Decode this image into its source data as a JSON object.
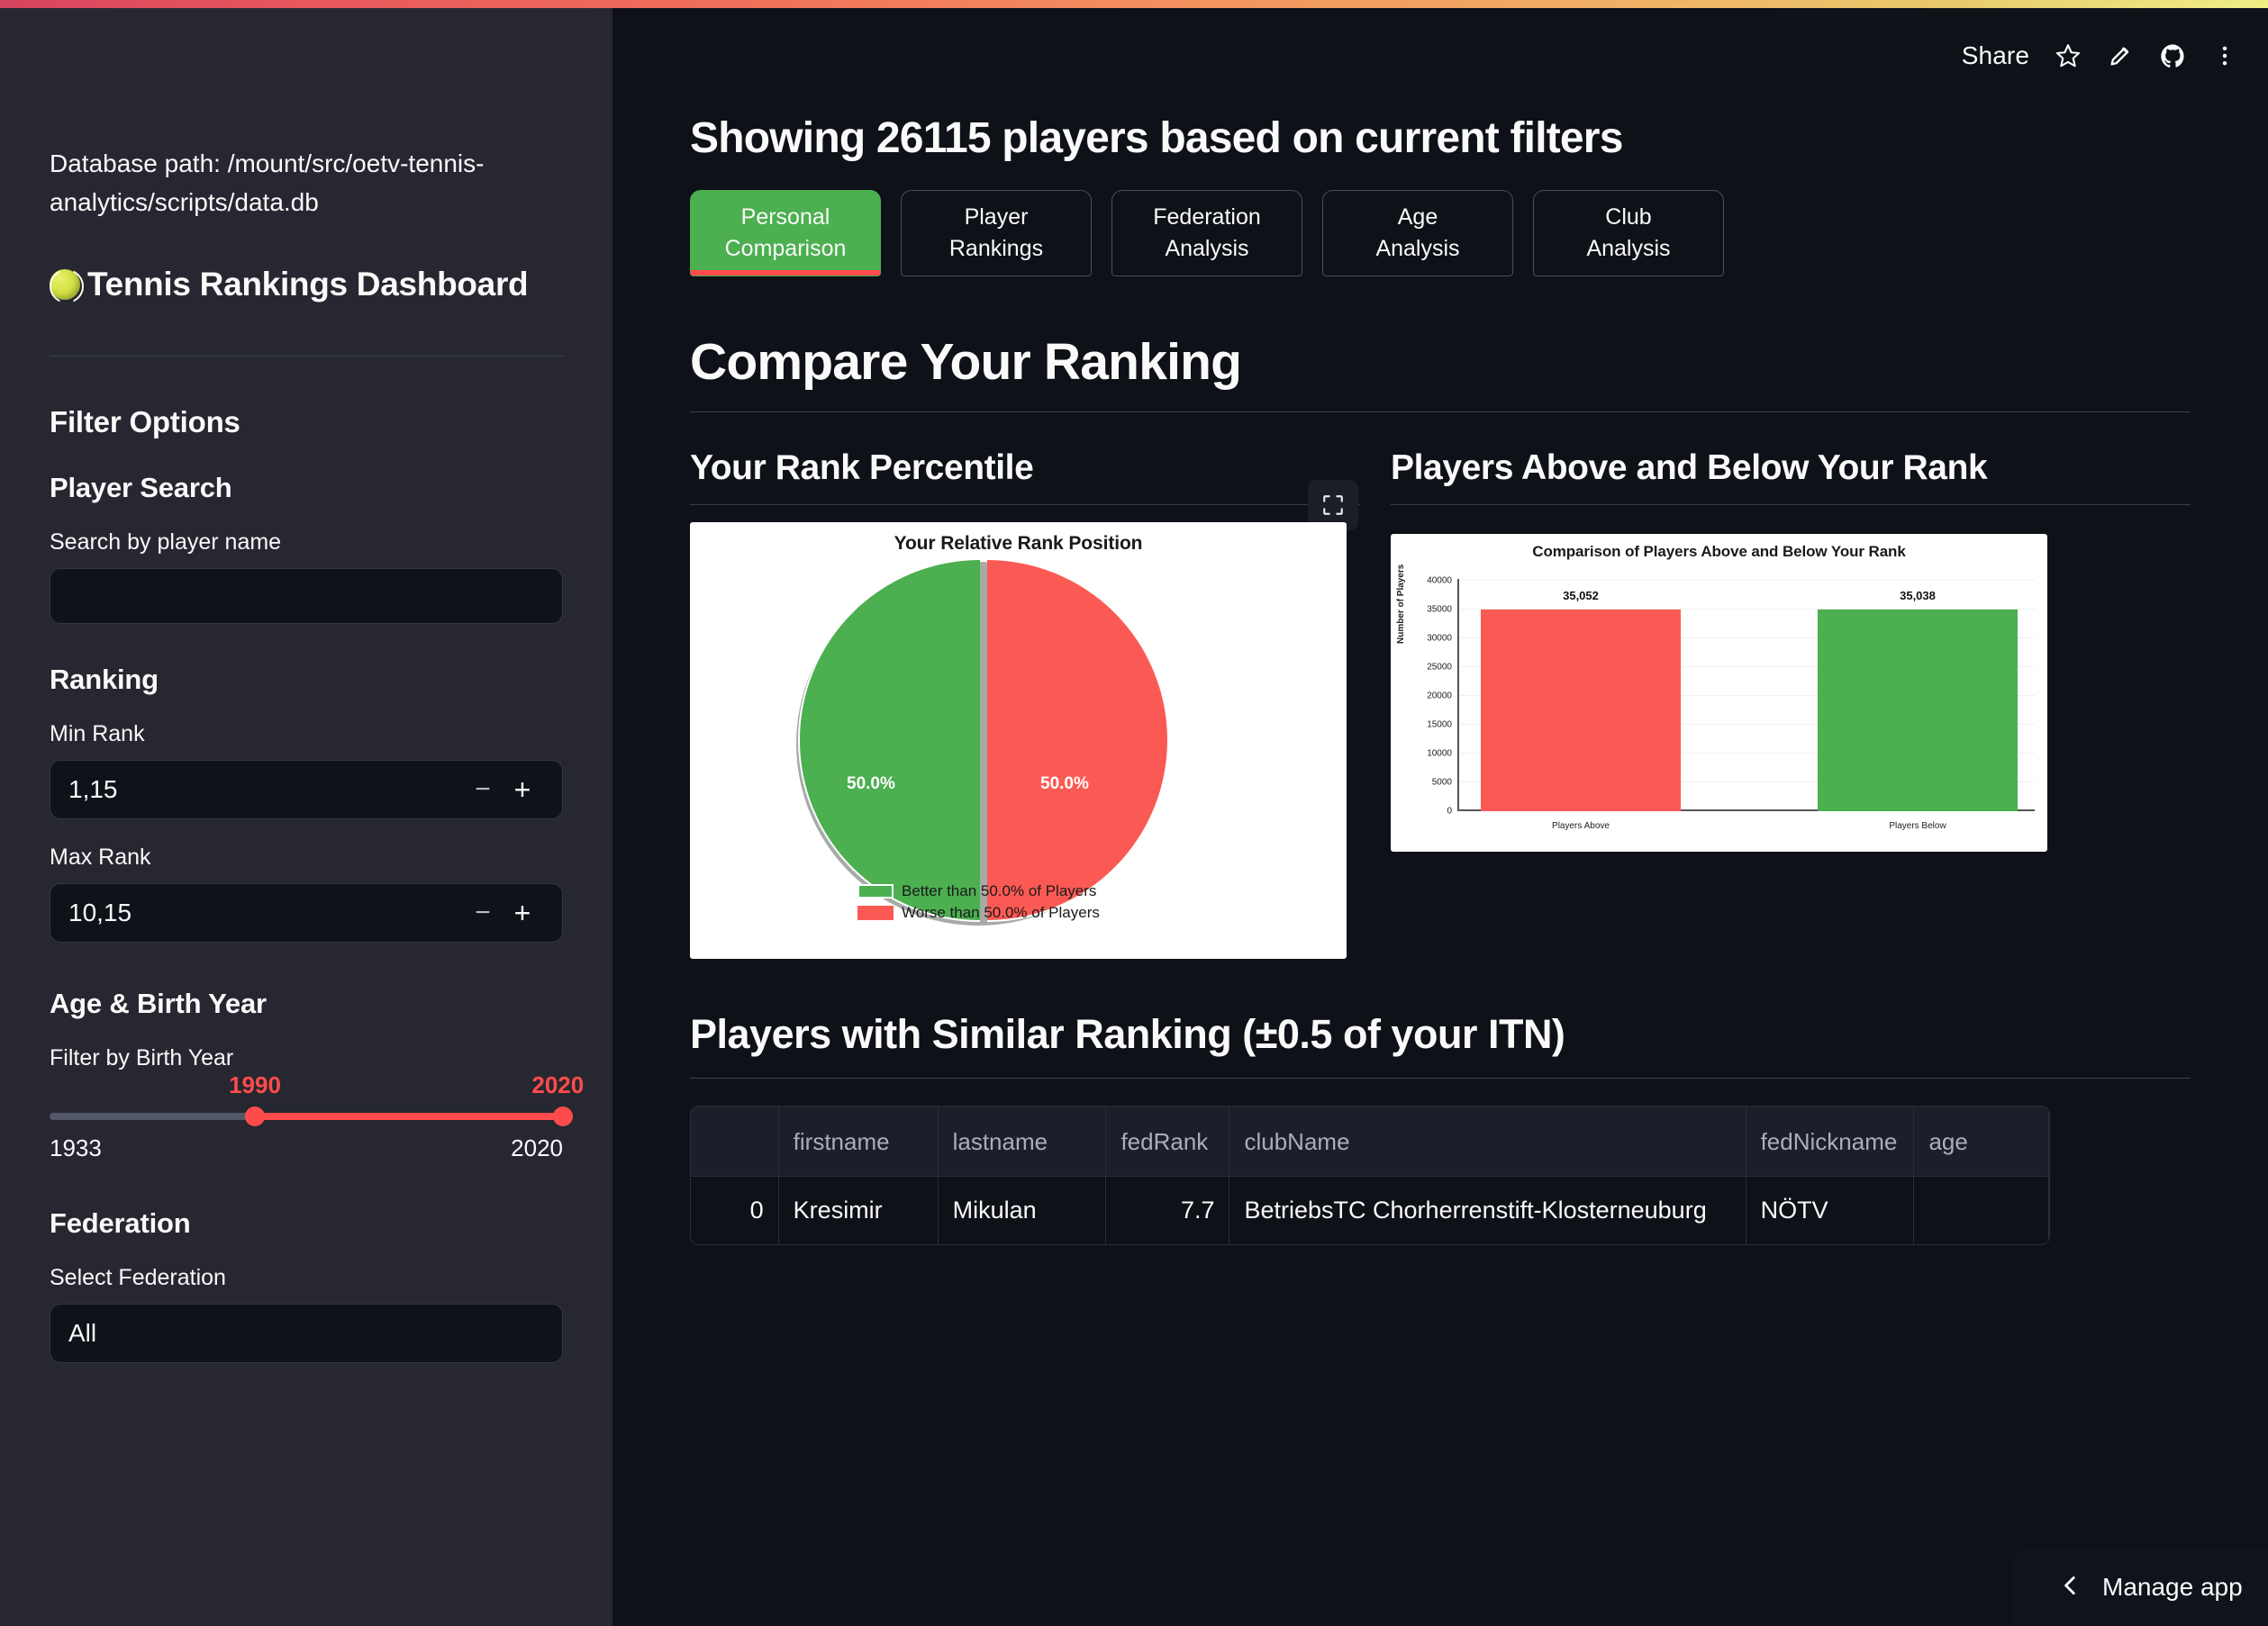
{
  "theme": {
    "accent_red": "#ff4b4b",
    "accent_green": "#4caf50",
    "bar_red": "#fb5a54",
    "sidebar_bg": "#262730",
    "main_bg": "#0e1117",
    "text": "#fafafa"
  },
  "sidebar": {
    "db_path": "Database path: /mount/src/oetv-tennis-analytics/scripts/data.db",
    "app_title": "Tennis Rankings Dashboard",
    "ball_icon": "tennis-ball-icon",
    "filter_options_heading": "Filter Options",
    "player_search": {
      "heading": "Player Search",
      "label": "Search by player name",
      "value": "",
      "placeholder": ""
    },
    "ranking": {
      "heading": "Ranking",
      "min_label": "Min Rank",
      "min_value": "1,15",
      "max_label": "Max Rank",
      "max_value": "10,15",
      "minus_label": "−",
      "plus_label": "+"
    },
    "age_birth": {
      "heading": "Age & Birth Year",
      "label": "Filter by Birth Year",
      "selected_low": "1990",
      "selected_high": "2020",
      "range_min": "1933",
      "range_max": "2020"
    },
    "federation": {
      "heading": "Federation",
      "label": "Select Federation",
      "value": "All"
    }
  },
  "toolbar": {
    "share_label": "Share",
    "star_icon": "star-icon",
    "edit_icon": "pencil-icon",
    "github_icon": "github-icon",
    "menu_icon": "overflow-menu-icon"
  },
  "header": {
    "showing_text": "Showing 26115 players based on current filters"
  },
  "tabs": [
    {
      "line1": "Personal",
      "line2": "Comparison",
      "active": true
    },
    {
      "line1": "Player",
      "line2": "Rankings",
      "active": false
    },
    {
      "line1": "Federation",
      "line2": "Analysis",
      "active": false
    },
    {
      "line1": "Age",
      "line2": "Analysis",
      "active": false
    },
    {
      "line1": "Club",
      "line2": "Analysis",
      "active": false
    }
  ],
  "main": {
    "page_heading": "Compare Your Ranking",
    "left_section_heading": "Your Rank Percentile",
    "right_section_heading": "Players Above and Below Your Rank",
    "expand_icon": "fullscreen-icon",
    "table_heading": "Players with Similar Ranking (±0.5 of your ITN)"
  },
  "chart_data": [
    {
      "type": "pie",
      "title": "Your Relative Rank Position",
      "labels": [
        "Better than 50.0% of Players",
        "Worse than 50.0% of Players"
      ],
      "values": [
        50.0,
        50.0
      ],
      "value_labels": [
        "50.0%",
        "50.0%"
      ],
      "colors": [
        "#4caf50",
        "#fb5a54"
      ],
      "exploded": true,
      "shadow": true,
      "legend_position": "bottom"
    },
    {
      "type": "bar",
      "title": "Comparison of Players Above and Below Your Rank",
      "categories": [
        "Players Above",
        "Players Below"
      ],
      "values": [
        35052,
        35038
      ],
      "value_labels": [
        "35,052",
        "35,038"
      ],
      "colors": [
        "#fb5a54",
        "#4caf50"
      ],
      "xlabel": "",
      "ylabel": "Number of Players",
      "ylim": [
        0,
        40000
      ],
      "yticks": [
        0,
        5000,
        10000,
        15000,
        20000,
        25000,
        30000,
        35000,
        40000
      ],
      "ytick_labels": [
        "0",
        "5000",
        "10000",
        "15000",
        "20000",
        "25000",
        "30000",
        "35000",
        "40000"
      ],
      "grid": true
    }
  ],
  "table": {
    "columns": [
      "",
      "firstname",
      "lastname",
      "fedRank",
      "clubName",
      "fedNickname",
      "age"
    ],
    "rows": [
      {
        "index": "0",
        "firstname": "Kresimir",
        "lastname": "Mikulan",
        "fedRank": "7.7",
        "clubName": "BetriebsTC Chorherrenstift-Klosterneuburg",
        "fedNickname": "NÖTV",
        "age": ""
      }
    ]
  },
  "footer": {
    "manage_app_label": "Manage app",
    "chevron_icon": "chevron-left-icon"
  }
}
